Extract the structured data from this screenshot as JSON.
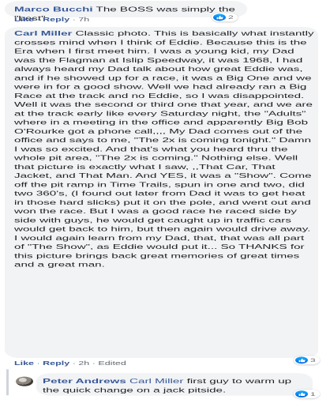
{
  "comments": [
    {
      "author": "Marco Bucchi",
      "text": "The BOSS was simply the \"best\"",
      "like_label": "Like",
      "reply_label": "Reply",
      "time": "7h",
      "reaction_count": "2"
    },
    {
      "author": "Carl Miller",
      "text": "Classic photo. This is basically what instantly crosses mind when I think of Eddie. Because this is the Era when I first meet him. I was a young kid, my Dad was the Flagman at Islip Speedway, it was 1968, I had always heard my Dad talk about how great Eddie was, and if he showed up for a race, it was a Big One and we were in for a good show. Well we had already ran a Big Race at the track and no Eddie, so I was disappointed. Well it was the second or third one that year, and we are at the track early like every Saturday night, the \"Adults\" where in a meeting in the office and apparently Big Bob O'Rourke got a phone call,,,, My Dad comes out of the office and says to me, \"The 2x is coming tonight.\" Damn I was so excited. And that's what you heard thru the whole pit area, \"The 2x is coming.\" Nothing else. Well that picture is exactly what I saw, ,,That Car, That Jacket, and That Man. And YES, it was a \"Show\". Come off the pit ramp in Time Trails, spun in one and two, did two 360's, (I found out later from Dad it was to get heat in those hard slicks) put it on the pole, and went out and won the race. But I was a good race he raced side by side with guys, he would get caught up in traffic cars would get back to him, but then again would drive away. I would again learn from my Dad, that, that was all part of \"The Show\", as Eddie would put it... So THANKS for this picture brings back great memories of great times and a great man.",
      "like_label": "Like",
      "reply_label": "Reply",
      "time": "2h",
      "edited_label": "Edited",
      "reaction_count": "3"
    }
  ],
  "reply": {
    "author": "Peter Andrews",
    "mention": "Carl Miller",
    "text": "first guy to warm up the quick change on a jack pitside.",
    "reaction_count": "1"
  },
  "colors": {
    "link": "#385898",
    "bubble": "#f2f3f5",
    "like_blue": "#1877f2"
  },
  "icons": {
    "like": "thumbs-up-icon"
  }
}
